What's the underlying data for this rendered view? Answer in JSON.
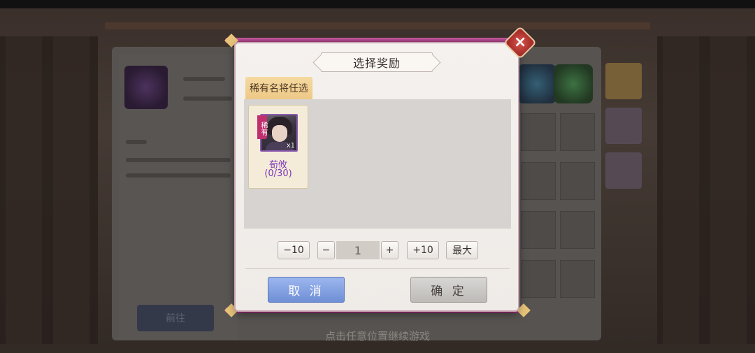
{
  "background": {
    "footer_hint": "点击任意位置继续游戏",
    "behind_button": "前往"
  },
  "dialog": {
    "title": "选择奖励",
    "tab_label": "稀有名将任选",
    "card": {
      "rarity": "稀有",
      "quantity": "x1",
      "name": "荀攸",
      "progress": "(0/30)"
    },
    "stepper": {
      "minus10": "−10",
      "minus1": "−",
      "value": "1",
      "plus1": "+",
      "plus10": "+10",
      "max": "最大"
    },
    "cancel_label": "取 消",
    "confirm_label": "确 定"
  },
  "colors": {
    "cancel": "#7f9ee0",
    "confirm": "#c9c6c3",
    "tab": "#f0cd8c",
    "hero_name": "#7a35b8",
    "close": "#c0433c"
  },
  "icons": [
    "close-icon"
  ]
}
